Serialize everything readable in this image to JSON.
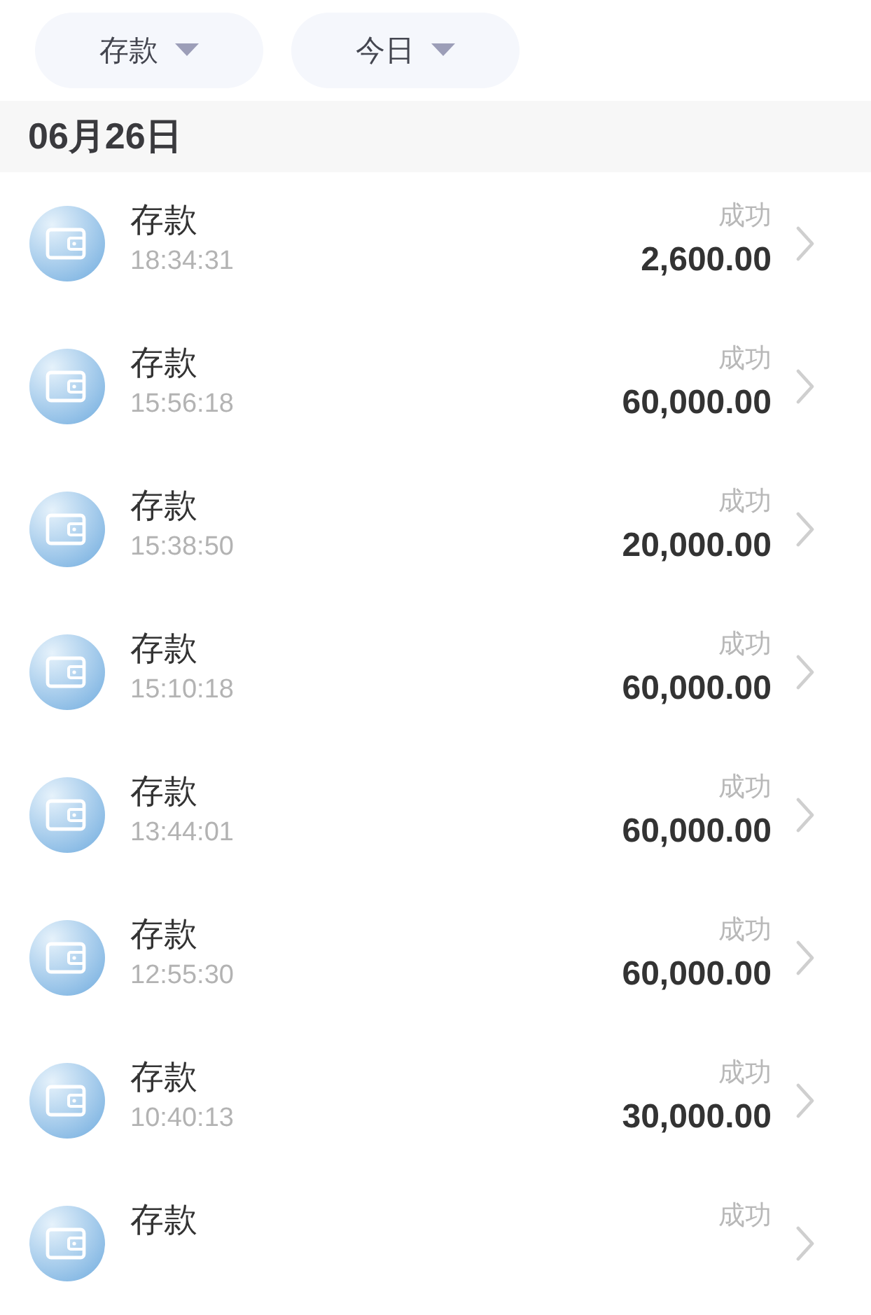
{
  "filters": [
    {
      "label": "存款"
    },
    {
      "label": "今日"
    }
  ],
  "date_header": "06月26日",
  "transactions": [
    {
      "title": "存款",
      "time": "18:34:31",
      "status": "成功",
      "amount": "2,600.00"
    },
    {
      "title": "存款",
      "time": "15:56:18",
      "status": "成功",
      "amount": "60,000.00"
    },
    {
      "title": "存款",
      "time": "15:38:50",
      "status": "成功",
      "amount": "20,000.00"
    },
    {
      "title": "存款",
      "time": "15:10:18",
      "status": "成功",
      "amount": "60,000.00"
    },
    {
      "title": "存款",
      "time": "13:44:01",
      "status": "成功",
      "amount": "60,000.00"
    },
    {
      "title": "存款",
      "time": "12:55:30",
      "status": "成功",
      "amount": "60,000.00"
    },
    {
      "title": "存款",
      "time": "10:40:13",
      "status": "成功",
      "amount": "30,000.00"
    },
    {
      "title": "存款",
      "status": "成功"
    }
  ]
}
